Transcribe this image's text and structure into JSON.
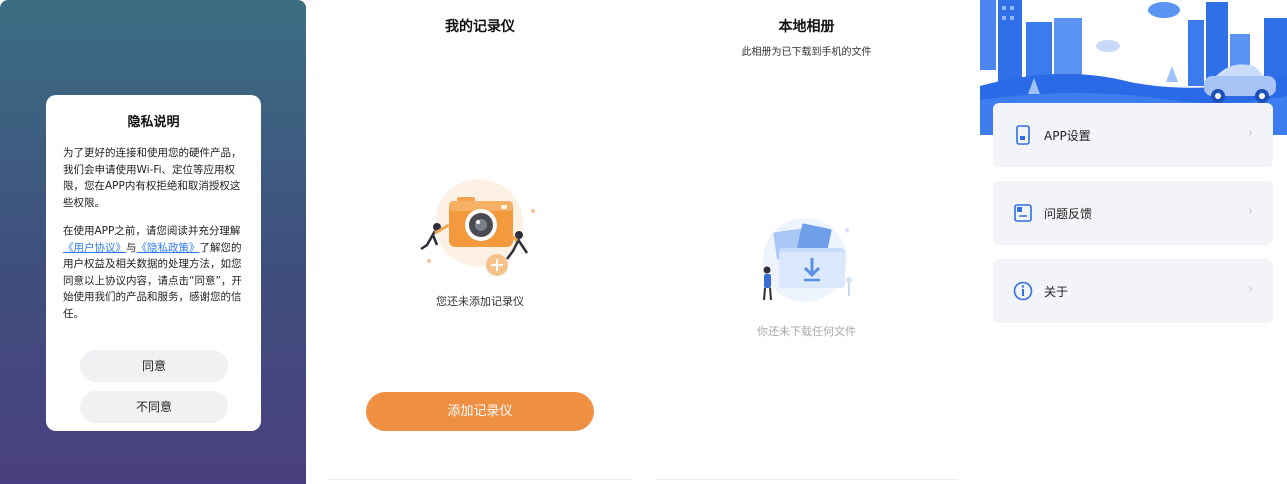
{
  "privacy_dialog": {
    "title": "隐私说明",
    "para1": "为了更好的连接和使用您的硬件产品，我们会申请使用Wi-Fi、定位等应用权限，您在APP内有权拒绝和取消授权这些权限。",
    "para2_a": "在使用APP之前，请您阅读并充分理解",
    "user_agreement_link": "《用户协议》",
    "para2_b": "与",
    "privacy_policy_link": "《隐私政策》",
    "para2_c": "了解您的用户权益及相关数据的处理方法，如您同意以上协议内容，请点击“同意”，开始使用我们的产品和服务，感谢您的信任。",
    "agree_label": "同意",
    "disagree_label": "不同意"
  },
  "my_recorder": {
    "title": "我的记录仪",
    "empty_text": "您还未添加记录仪",
    "add_button_label": "添加记录仪"
  },
  "local_album": {
    "title": "本地相册",
    "subtitle": "此相册为已下载到手机的文件",
    "empty_text": "你还未下载任何文件"
  },
  "settings": {
    "items": [
      {
        "label": "APP设置",
        "icon": "phone-settings-icon"
      },
      {
        "label": "问题反馈",
        "icon": "feedback-icon"
      },
      {
        "label": "关于",
        "icon": "info-icon"
      }
    ]
  },
  "colors": {
    "accent_orange": "#ee8f42",
    "link_blue": "#2f7df5",
    "banner_blue": "#3a7cf0",
    "dialog_bg_top": "#3b6e82",
    "dialog_bg_bottom": "#4a3f80"
  }
}
